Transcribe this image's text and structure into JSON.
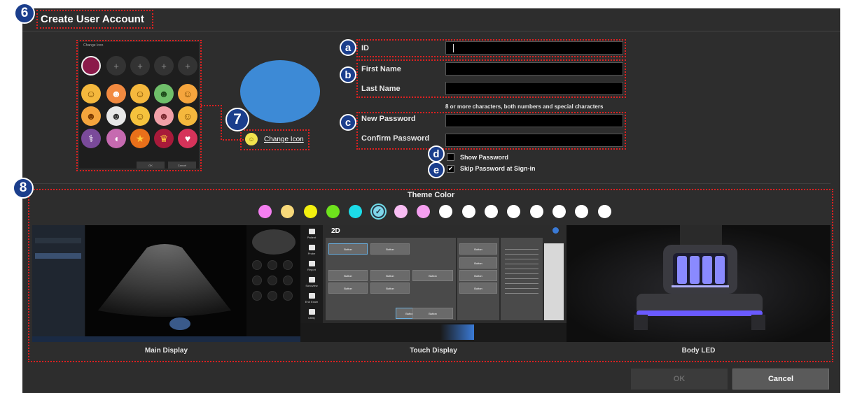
{
  "dialog": {
    "title": "Create User Account"
  },
  "callouts": {
    "c6": "6",
    "c7": "7",
    "c8": "8",
    "a": "a",
    "b": "b",
    "c": "c",
    "d": "d",
    "e": "e"
  },
  "icon_picker": {
    "title": "Change Icon",
    "ok_label": "OK",
    "cancel_label": "Cancel",
    "empty_glyph": "+",
    "icons": [
      "smile-face",
      "mask-face",
      "sleepy-face",
      "green-face",
      "tiger-face",
      "lion-face",
      "panda-face",
      "yellow-face",
      "pig-face",
      "cat-face",
      "stethoscope",
      "pill",
      "star",
      "crown",
      "heart"
    ]
  },
  "avatar": {
    "color": "#3d8ad6",
    "change_icon_label": "Change Icon"
  },
  "form": {
    "id_label": "ID",
    "first_name_label": "First Name",
    "last_name_label": "Last Name",
    "password_hint": "8 or more characters, both numbers and special characters",
    "new_password_label": "New Password",
    "confirm_password_label": "Confirm Password",
    "show_password_label": "Show Password",
    "show_password_checked": false,
    "skip_password_label": "Skip Password at Sign-in",
    "skip_password_checked": true,
    "check_glyph": "✔"
  },
  "theme": {
    "title": "Theme Color",
    "selected_index": 5,
    "check_glyph": "✓",
    "colors": [
      "#f47ef0",
      "#f8d97a",
      "#f3f00f",
      "#6ee21c",
      "#1cdce8",
      "#7fd6ea",
      "#f8bdf3",
      "#f59ff0",
      "#ffffff",
      "#ffffff",
      "#ffffff",
      "#ffffff",
      "#ffffff",
      "#ffffff",
      "#ffffff",
      "#ffffff"
    ],
    "previews": [
      {
        "label": "Main Display"
      },
      {
        "label": "Touch Display"
      },
      {
        "label": "Body LED"
      }
    ],
    "touch": {
      "mode": "2D",
      "button_label": "Button",
      "nav": [
        "Patient",
        "Probe",
        "Report",
        "Sonoview",
        "End Exam",
        "Utility"
      ]
    }
  },
  "footer": {
    "ok_label": "OK",
    "cancel_label": "Cancel"
  }
}
